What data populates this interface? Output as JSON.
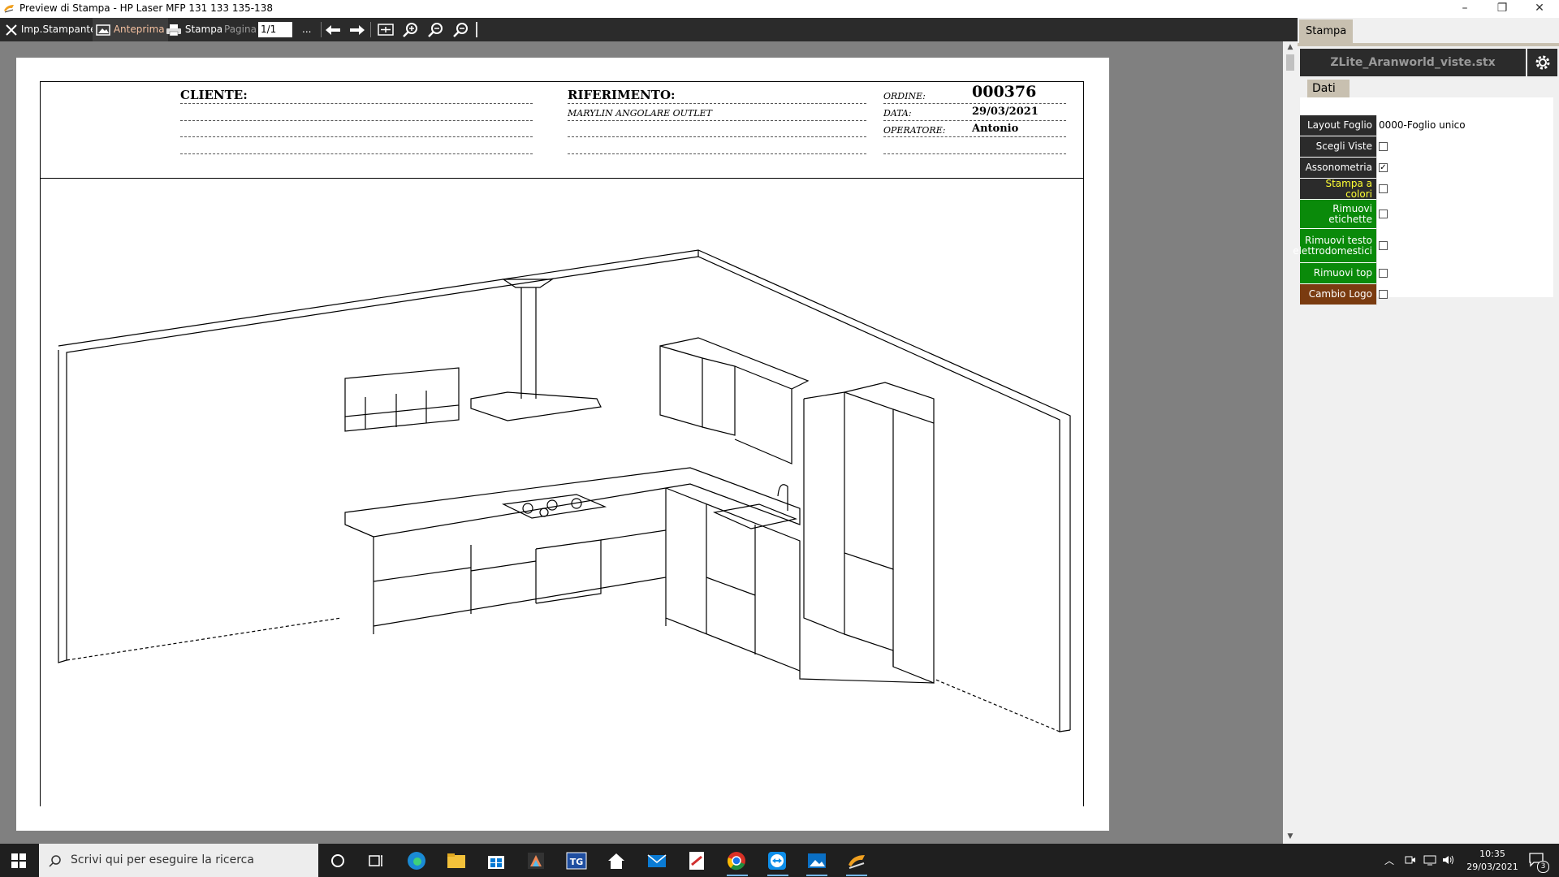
{
  "window": {
    "title": "Preview di Stampa - HP Laser MFP 131 133 135-138",
    "controls": [
      "–",
      "❐",
      "✕"
    ]
  },
  "toolbar": {
    "printer_setup": "Imp.Stampante",
    "preview": "Anteprima",
    "print": "Stampa",
    "page_label": "Pagina",
    "page_value": "1/1",
    "more": "..."
  },
  "document": {
    "cliente_label": "CLIENTE:",
    "riferimento_label": "RIFERIMENTO:",
    "riferimento_value": "MARYLIN ANGOLARE OUTLET",
    "ordine_label": "ORDINE:",
    "ordine_value": "000376",
    "data_label": "DATA:",
    "data_value": "29/03/2021",
    "operatore_label": "OPERATORE:",
    "operatore_value": "Antonio"
  },
  "panel": {
    "tab": "Stampa",
    "filename": "ZLite_Aranworld_viste.stx",
    "section_tab": "Dati",
    "rows": [
      {
        "label": "Layout Foglio",
        "value": "0000-Foglio unico",
        "color": "#2b2b2b",
        "text_color": "#ffffff",
        "type": "text"
      },
      {
        "label": "Scegli Viste",
        "checked": false,
        "color": "#2b2b2b",
        "text_color": "#ffffff",
        "type": "check"
      },
      {
        "label": "Assonometria",
        "checked": true,
        "color": "#2b2b2b",
        "text_color": "#ffffff",
        "type": "check"
      },
      {
        "label": "Stampa a colori",
        "checked": false,
        "color": "#2b2b2b",
        "text_color": "#ffff33",
        "type": "check"
      },
      {
        "label": "Rimuovi etichette",
        "checked": false,
        "color": "#0a8a0a",
        "text_color": "#ffffff",
        "type": "check"
      },
      {
        "label": "Rimuovi testo elettrodomestici",
        "checked": false,
        "color": "#0a8a0a",
        "text_color": "#ffffff",
        "type": "check"
      },
      {
        "label": "Rimuovi top",
        "checked": false,
        "color": "#0a8a0a",
        "text_color": "#ffffff",
        "type": "check"
      },
      {
        "label": "Cambio Logo",
        "checked": false,
        "color": "#7a3b10",
        "text_color": "#ffffff",
        "type": "check"
      }
    ]
  },
  "taskbar": {
    "search_placeholder": "Scrivi qui per eseguire la ricerca",
    "time": "10:35",
    "date": "29/03/2021",
    "notifications": "3"
  }
}
